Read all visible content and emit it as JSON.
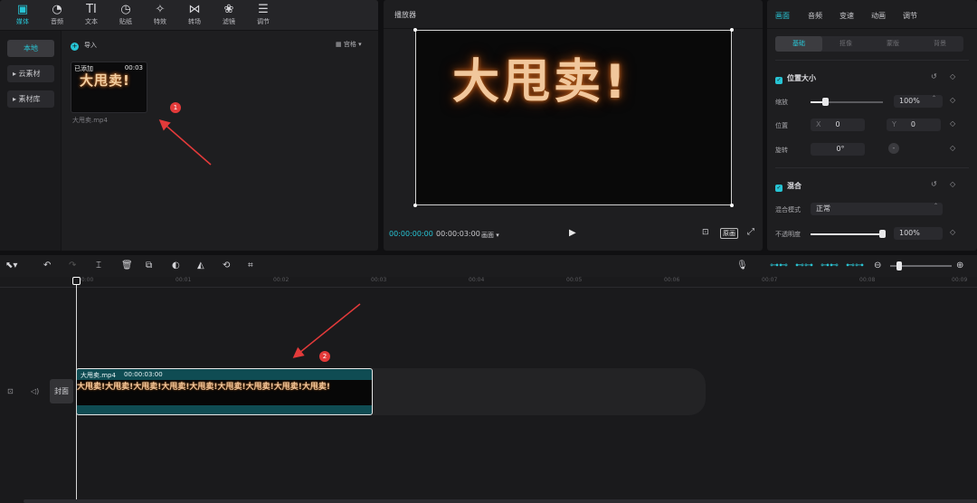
{
  "media_toolbar": {
    "tabs": [
      {
        "label": "媒体",
        "icon": "play-square-icon",
        "active": true
      },
      {
        "label": "音频",
        "icon": "audio-icon"
      },
      {
        "label": "文本",
        "icon": "text-icon"
      },
      {
        "label": "贴纸",
        "icon": "sticker-icon"
      },
      {
        "label": "特效",
        "icon": "effect-icon"
      },
      {
        "label": "转场",
        "icon": "transition-icon"
      },
      {
        "label": "滤镜",
        "icon": "filter-icon"
      },
      {
        "label": "调节",
        "icon": "adjust-icon"
      }
    ]
  },
  "sidenav": {
    "items": [
      "本地",
      "▸ 云素材",
      "▸ 素材库"
    ]
  },
  "media": {
    "import_label": "导入",
    "view_label": "宫格",
    "thumb_added": "已添加",
    "thumb_duration": "00:03",
    "thumb_art": "大甩卖!",
    "file_name": "大甩卖.mp4",
    "badge_1": "1"
  },
  "player": {
    "title": "播放器",
    "screen_text": "大甩卖!",
    "current_time": "00:00:00:00",
    "total_time": "00:00:03:00",
    "ratio_label": "画面",
    "original_label": "原画"
  },
  "props": {
    "tabs": [
      "画面",
      "音频",
      "变速",
      "动画",
      "调节"
    ],
    "subtabs": [
      "基础",
      "抠像",
      "蒙版",
      "背景"
    ],
    "position_size": "位置大小",
    "scale_label": "缩放",
    "scale_value": "100%",
    "scale_fraction": 0.2,
    "position_label": "位置",
    "pos_x_label": "X",
    "pos_x": "0",
    "pos_y_label": "Y",
    "pos_y": "0",
    "rotate_label": "旋转",
    "rotate_value": "0°",
    "blend": "混合",
    "blend_mode_label": "混合模式",
    "blend_mode_value": "正常",
    "opacity_label": "不透明度",
    "opacity_value": "100%",
    "opacity_fraction": 1.0
  },
  "timeline": {
    "ticks": [
      "00:00",
      "00:01",
      "00:02",
      "00:03",
      "00:04",
      "00:05",
      "00:06",
      "00:07",
      "00:08",
      "00:09"
    ],
    "cover_label": "封面",
    "clip_name": "大甩卖.mp4",
    "clip_duration": "00:00:03:00",
    "clip_strip": "大甩卖!大甩卖!大甩卖!大甩卖!大甩卖!大甩卖!大甩卖!大甩卖!大甩卖!",
    "badge_2": "2"
  }
}
